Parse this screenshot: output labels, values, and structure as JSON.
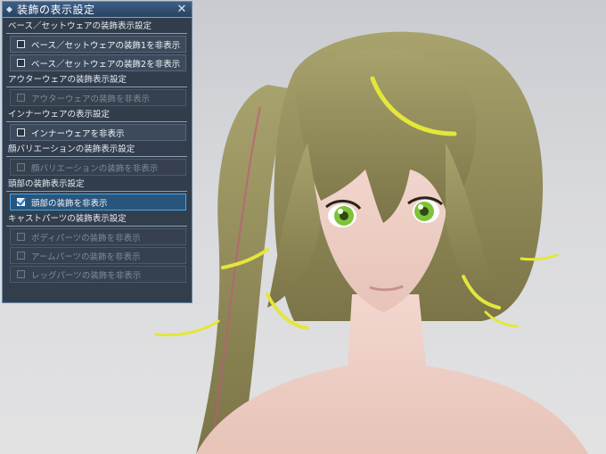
{
  "panel": {
    "title": "装飾の表示設定",
    "title_icon": "diamond-icon",
    "close_icon": "close-icon",
    "close_glyph": "✕",
    "sections": [
      {
        "header": "ベース／セットウェアの装飾表示設定",
        "options": [
          {
            "label": "ベース／セットウェアの装飾1を非表示",
            "checked": false,
            "enabled": true
          },
          {
            "label": "ベース／セットウェアの装飾2を非表示",
            "checked": false,
            "enabled": true
          }
        ]
      },
      {
        "header": "アウターウェアの装飾表示設定",
        "options": [
          {
            "label": "アウターウェアの装飾を非表示",
            "checked": false,
            "enabled": false
          }
        ]
      },
      {
        "header": "インナーウェアの表示設定",
        "options": [
          {
            "label": "インナーウェアを非表示",
            "checked": false,
            "enabled": true
          }
        ]
      },
      {
        "header": "顔バリエーションの装飾表示設定",
        "options": [
          {
            "label": "顔バリエーションの装飾を非表示",
            "checked": false,
            "enabled": false
          }
        ]
      },
      {
        "header": "頭部の装飾表示設定",
        "options": [
          {
            "label": "頭部の装飾を非表示",
            "checked": true,
            "enabled": true,
            "selected": true
          }
        ]
      },
      {
        "header": "キャストパーツの装飾表示設定",
        "options": [
          {
            "label": "ボディパーツの装飾を非表示",
            "checked": false,
            "enabled": false
          },
          {
            "label": "アームパーツの装飾を非表示",
            "checked": false,
            "enabled": false
          },
          {
            "label": "レッグパーツの装飾を非表示",
            "checked": false,
            "enabled": false
          }
        ]
      }
    ]
  },
  "colors": {
    "panel_bg": "#263242",
    "panel_border": "#6f8aa6",
    "highlight": "#46a6e6",
    "hair": "#8f8a5c",
    "hair_streak": "#e4e63a",
    "eye": "#7ec23a"
  }
}
